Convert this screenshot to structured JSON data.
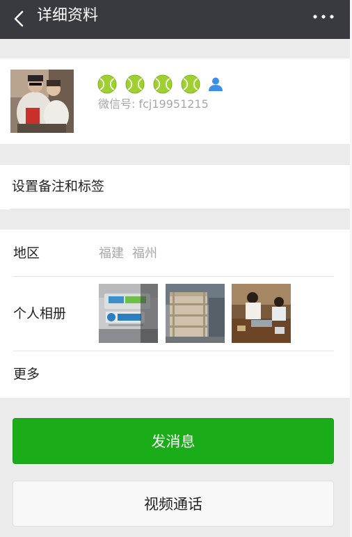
{
  "header": {
    "title": "详细资料"
  },
  "profile": {
    "badge_count": 4,
    "wechat_id": "微信号: fcj19951215"
  },
  "remark": {
    "label": "设置备注和标签"
  },
  "info": {
    "region_label": "地区",
    "region_province": "福建",
    "region_city": "福州",
    "album_label": "个人相册",
    "album_photos": [
      "photo-1",
      "photo-2",
      "photo-3"
    ],
    "more_label": "更多"
  },
  "actions": {
    "send_message": "发消息",
    "video_call": "视频通话"
  },
  "colors": {
    "navbar": "#393a3f",
    "primary": "#1aad19",
    "background": "#ebebeb"
  }
}
